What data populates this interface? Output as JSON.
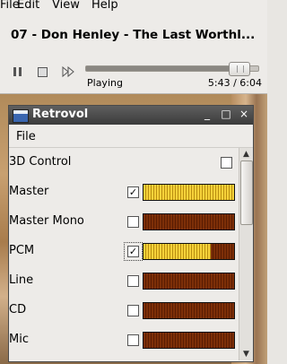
{
  "player": {
    "menu": [
      "File",
      "Edit",
      "View",
      "Help"
    ],
    "track_title": "07 - Don Henley - The Last Worthl...",
    "status": "Playing",
    "time": "5:43 / 6:04",
    "progress_fraction": 0.944
  },
  "retrovol": {
    "window_title": "Retrovol",
    "title_buttons": [
      "_",
      "□",
      "×"
    ],
    "menu_file": "File",
    "channels": [
      {
        "label": "3D Control",
        "checked": false,
        "has_bar": false
      },
      {
        "label": "Master",
        "checked": true,
        "has_bar": true,
        "level": 1.0
      },
      {
        "label": "Master Mono",
        "checked": false,
        "has_bar": true,
        "level": 0.0
      },
      {
        "label": "PCM",
        "checked": true,
        "has_bar": true,
        "level": 0.74
      },
      {
        "label": "Line",
        "checked": false,
        "has_bar": true,
        "level": 0.0
      },
      {
        "label": "CD",
        "checked": false,
        "has_bar": true,
        "level": 0.0
      },
      {
        "label": "Mic",
        "checked": false,
        "has_bar": true,
        "level": 0.0
      }
    ]
  }
}
